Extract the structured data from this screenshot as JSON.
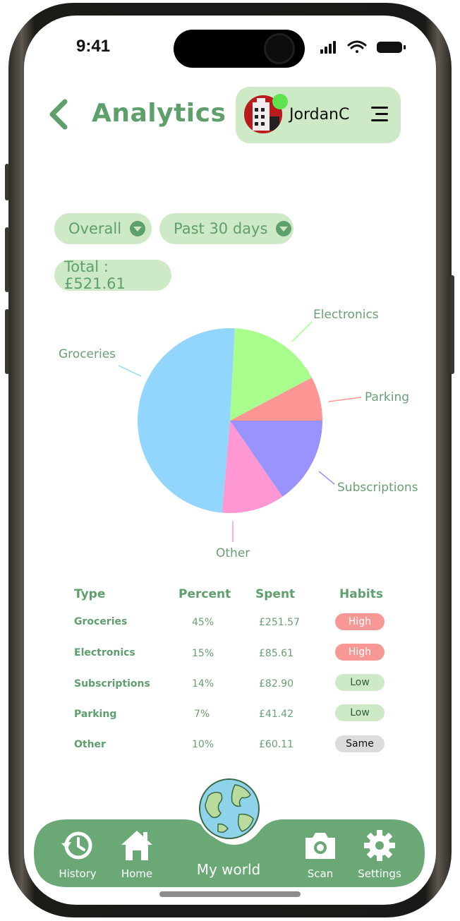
{
  "status_bar": {
    "time": "9:41"
  },
  "header": {
    "title": "Analytics",
    "username": "JordanC"
  },
  "filters": {
    "scope": "Overall",
    "period": "Past 30 days",
    "total": "Total : £521.61"
  },
  "colors": {
    "accent": "#5e9f6c",
    "pill_bg": "#cde9c6",
    "nav_bg": "#6aa876",
    "groceries": "#93d6fd",
    "electronics": "#a7fe8d",
    "parking": "#fc9694",
    "subscriptions": "#9a93fe",
    "other": "#fe97d2",
    "habit_high": "#f79796",
    "habit_low": "#cde9c6",
    "habit_same": "#dcdcdc"
  },
  "chart_data": {
    "type": "pie",
    "labels": [
      "Groceries",
      "Electronics",
      "Parking",
      "Subscriptions",
      "Other"
    ],
    "values": [
      45,
      15,
      7,
      14,
      10
    ],
    "colors": [
      "#93d6fd",
      "#a7fe8d",
      "#fc9694",
      "#9a93fe",
      "#fe97d2"
    ]
  },
  "table": {
    "headers": [
      "Type",
      "Percent",
      "Spent",
      "Habits"
    ],
    "rows": [
      {
        "type": "Groceries",
        "percent": "45%",
        "spent": "£251.57",
        "habit": "High",
        "level": "high"
      },
      {
        "type": "Electronics",
        "percent": "15%",
        "spent": "£85.61",
        "habit": "High",
        "level": "high"
      },
      {
        "type": "Subscriptions",
        "percent": "14%",
        "spent": "£82.90",
        "habit": "Low",
        "level": "low"
      },
      {
        "type": "Parking",
        "percent": "7%",
        "spent": "£41.42",
        "habit": "Low",
        "level": "low"
      },
      {
        "type": "Other",
        "percent": "10%",
        "spent": "£60.11",
        "habit": "Same",
        "level": "same"
      }
    ]
  },
  "nav": {
    "history": "History",
    "home": "Home",
    "myworld": "My world",
    "scan": "Scan",
    "settings": "Settings"
  }
}
